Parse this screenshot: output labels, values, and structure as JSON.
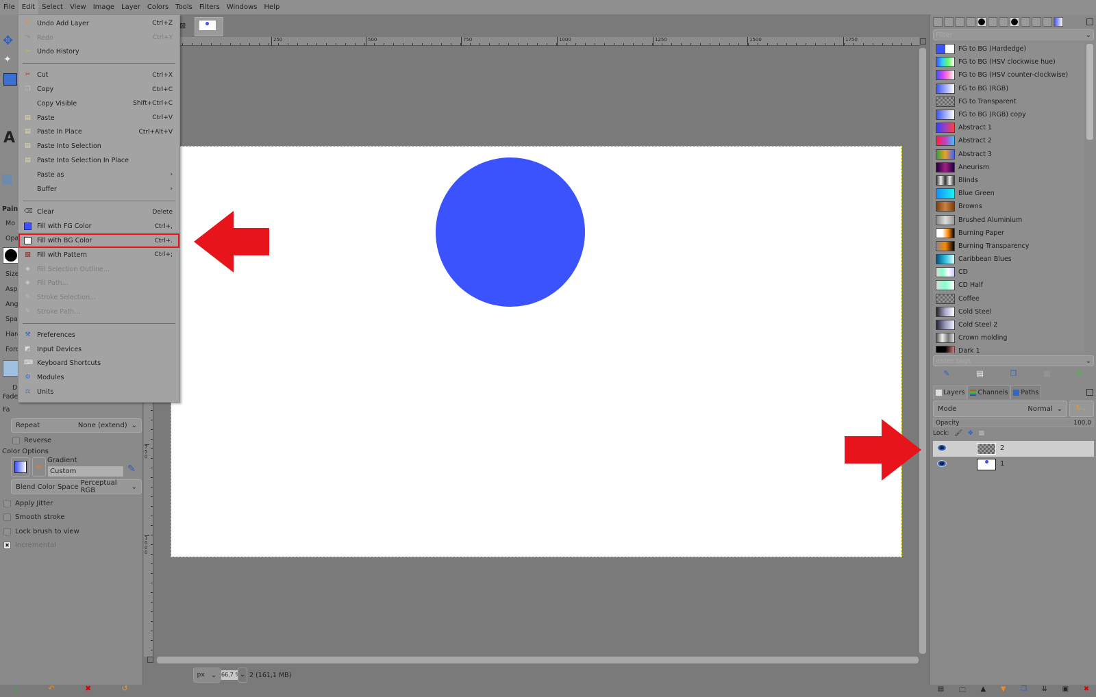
{
  "menubar": [
    "File",
    "Edit",
    "Select",
    "View",
    "Image",
    "Layer",
    "Colors",
    "Tools",
    "Filters",
    "Windows",
    "Help"
  ],
  "edit_menu": [
    {
      "label": "Undo Add Layer",
      "shortcut": "Ctrl+Z",
      "icon": "undo-icon",
      "enabled": true
    },
    {
      "label": "Redo",
      "shortcut": "Ctrl+Y",
      "icon": "redo-icon",
      "enabled": false
    },
    {
      "label": "Undo History",
      "shortcut": "",
      "icon": "undo-history-icon",
      "enabled": true
    },
    {
      "sep": true
    },
    {
      "label": "Cut",
      "shortcut": "Ctrl+X",
      "icon": "scissors-icon",
      "enabled": true
    },
    {
      "label": "Copy",
      "shortcut": "Ctrl+C",
      "icon": "copy-icon",
      "enabled": true
    },
    {
      "label": "Copy Visible",
      "shortcut": "Shift+Ctrl+C",
      "icon": "",
      "enabled": true
    },
    {
      "label": "Paste",
      "shortcut": "Ctrl+V",
      "icon": "paste-icon",
      "enabled": true
    },
    {
      "label": "Paste In Place",
      "shortcut": "Ctrl+Alt+V",
      "icon": "paste-icon",
      "enabled": true
    },
    {
      "label": "Paste Into Selection",
      "shortcut": "",
      "icon": "paste-icon",
      "enabled": true
    },
    {
      "label": "Paste Into Selection In Place",
      "shortcut": "",
      "icon": "paste-icon",
      "enabled": true
    },
    {
      "label": "Paste as",
      "shortcut": "›",
      "icon": "",
      "enabled": true
    },
    {
      "label": "Buffer",
      "shortcut": "›",
      "icon": "",
      "enabled": true
    },
    {
      "sep": true
    },
    {
      "label": "Clear",
      "shortcut": "Delete",
      "icon": "eraser-icon",
      "enabled": true
    },
    {
      "label": "Fill with FG Color",
      "shortcut": "Ctrl+,",
      "icon": "fg-color-icon",
      "enabled": true
    },
    {
      "label": "Fill with BG Color",
      "shortcut": "Ctrl+.",
      "icon": "bg-color-icon",
      "enabled": true,
      "highlighted": true
    },
    {
      "label": "Fill with Pattern",
      "shortcut": "Ctrl+;",
      "icon": "pattern-icon",
      "enabled": true
    },
    {
      "label": "Fill Selection Outline...",
      "shortcut": "",
      "icon": "fill-icon",
      "enabled": false
    },
    {
      "label": "Fill Path...",
      "shortcut": "",
      "icon": "fill-icon",
      "enabled": false
    },
    {
      "label": "Stroke Selection...",
      "shortcut": "",
      "icon": "stroke-icon",
      "enabled": false
    },
    {
      "label": "Stroke Path...",
      "shortcut": "",
      "icon": "stroke-icon",
      "enabled": false
    },
    {
      "sep": true
    },
    {
      "label": "Preferences",
      "shortcut": "",
      "icon": "preferences-icon",
      "enabled": true
    },
    {
      "label": "Input Devices",
      "shortcut": "",
      "icon": "input-devices-icon",
      "enabled": true
    },
    {
      "label": "Keyboard Shortcuts",
      "shortcut": "",
      "icon": "keyboard-icon",
      "enabled": true
    },
    {
      "label": "Modules",
      "shortcut": "",
      "icon": "modules-icon",
      "enabled": true
    },
    {
      "label": "Units",
      "shortcut": "",
      "icon": "units-icon",
      "enabled": true
    }
  ],
  "rulers": {
    "top": [
      "250",
      "500",
      "750",
      "1000",
      "1250",
      "1500",
      "1750"
    ],
    "left": [
      "750",
      "1000"
    ]
  },
  "tool_options": {
    "fragments": [
      "Pain",
      "Mo",
      "Opa",
      "Size",
      "Aspe",
      "Angl",
      "Spac",
      "Hard",
      "Forc",
      "D",
      "Fade",
      "Fa"
    ],
    "repeat_label": "Repeat",
    "repeat_value": "None (extend)",
    "reverse": "Reverse",
    "color_options": "Color Options",
    "gradient_label": "Gradient",
    "gradient_value": "Custom",
    "blend_label": "Blend Color Space",
    "blend_value": "Perceptual RGB",
    "checks": [
      {
        "label": "Apply Jitter",
        "checked": false
      },
      {
        "label": "Smooth stroke",
        "checked": false
      },
      {
        "label": "Lock brush to view",
        "checked": false
      },
      {
        "label": "Incremental",
        "checked": true
      }
    ]
  },
  "gradients": {
    "filter_placeholder": "Filter",
    "tags_placeholder": "enter tags",
    "items": [
      {
        "name": "FG to BG (Hardedge)",
        "colors": [
          "#3b53ff",
          "#3b53ff",
          "#fff",
          "#fff"
        ]
      },
      {
        "name": "FG to BG (HSV clockwise hue)",
        "colors": [
          "#3b53ff",
          "#3cf",
          "#6f6",
          "#fff"
        ]
      },
      {
        "name": "FG to BG (HSV counter-clockwise)",
        "colors": [
          "#3b53ff",
          "#c4f",
          "#f8c",
          "#fff"
        ]
      },
      {
        "name": "FG to BG (RGB)",
        "colors": [
          "#3b53ff",
          "#fff"
        ]
      },
      {
        "name": "FG to Transparent",
        "colors": [
          "#3b53ff",
          "#888"
        ]
      },
      {
        "name": "FG to BG (RGB) copy",
        "colors": [
          "#3b53ff",
          "#fff"
        ]
      },
      {
        "name": "Abstract 1",
        "colors": [
          "#3040ff",
          "#a040c0",
          "#ff4040"
        ]
      },
      {
        "name": "Abstract 2",
        "colors": [
          "#ff2040",
          "#c040c0",
          "#40c0ff"
        ]
      },
      {
        "name": "Abstract 3",
        "colors": [
          "#30a040",
          "#f0a020",
          "#4060ff"
        ]
      },
      {
        "name": "Aneurism",
        "colors": [
          "#200040",
          "#a02080",
          "#200040"
        ]
      },
      {
        "name": "Blinds",
        "colors": [
          "#333",
          "#eee",
          "#333",
          "#eee",
          "#333"
        ]
      },
      {
        "name": "Blue Green",
        "colors": [
          "#1090ff",
          "#20f0f0"
        ]
      },
      {
        "name": "Browns",
        "colors": [
          "#7a4010",
          "#d08040",
          "#7a4010"
        ]
      },
      {
        "name": "Brushed Aluminium",
        "colors": [
          "#888",
          "#ddd",
          "#999"
        ]
      },
      {
        "name": "Burning Paper",
        "colors": [
          "#fff",
          "#fff",
          "#f80",
          "#000"
        ]
      },
      {
        "name": "Burning Transparency",
        "colors": [
          "#888",
          "#f80",
          "#000"
        ]
      },
      {
        "name": "Caribbean Blues",
        "colors": [
          "#005080",
          "#30c0e0",
          "#e0ffff"
        ]
      },
      {
        "name": "CD",
        "colors": [
          "#ddd",
          "#8fc",
          "#fff",
          "#ccf"
        ]
      },
      {
        "name": "CD Half",
        "colors": [
          "#ddd",
          "#8fc",
          "#fff"
        ]
      },
      {
        "name": "Coffee",
        "colors": [
          "#777",
          "#999"
        ]
      },
      {
        "name": "Cold Steel",
        "colors": [
          "#222",
          "#aac",
          "#fff"
        ]
      },
      {
        "name": "Cold Steel 2",
        "colors": [
          "#223",
          "#99b",
          "#eef"
        ]
      },
      {
        "name": "Crown molding",
        "colors": [
          "#555",
          "#eee",
          "#777",
          "#ddd"
        ]
      },
      {
        "name": "Dark 1",
        "colors": [
          "#000",
          "#000",
          "#d08080"
        ]
      }
    ]
  },
  "layers_panel": {
    "tabs": [
      "Layers",
      "Channels",
      "Paths"
    ],
    "mode_label": "Mode",
    "mode_value": "Normal",
    "opacity_label": "Opacity",
    "opacity_value": "100,0",
    "lock_label": "Lock:",
    "layers": [
      {
        "name": "2",
        "visible": true,
        "selected": true
      },
      {
        "name": "1",
        "visible": true,
        "selected": false
      }
    ]
  },
  "status": {
    "unit": "px",
    "zoom": "66,7 %",
    "info": "2 (161,1 MB)"
  },
  "colors": {
    "fg": "#3b53ff",
    "accent_red": "#e8141b",
    "circle": "#3b53ff"
  }
}
